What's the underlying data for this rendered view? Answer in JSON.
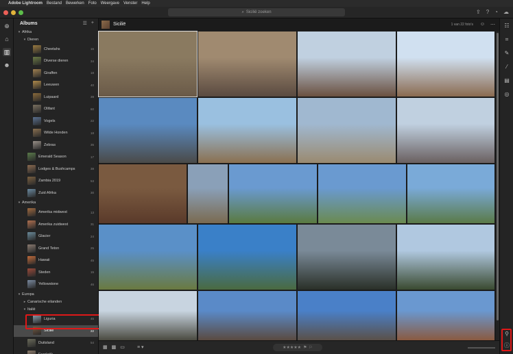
{
  "menubar": {
    "items": [
      "Adobe Lightroom",
      "Bestand",
      "Bewerken",
      "Foto",
      "Weergave",
      "Venster",
      "Help"
    ]
  },
  "search": {
    "placeholder": "Sicilië zoeken"
  },
  "panel": {
    "title": "Albums",
    "tree": [
      {
        "type": "group",
        "indent": 0,
        "label": "Afrika"
      },
      {
        "type": "group",
        "indent": 1,
        "label": "Dieren"
      },
      {
        "type": "album",
        "indent": 2,
        "label": "Cheetahs",
        "count": "16",
        "color": "#9a7a40"
      },
      {
        "type": "album",
        "indent": 2,
        "label": "Diverse dieren",
        "count": "34",
        "color": "#6b7a45"
      },
      {
        "type": "album",
        "indent": 2,
        "label": "Giraffen",
        "count": "18",
        "color": "#a08050"
      },
      {
        "type": "album",
        "indent": 2,
        "label": "Leeuwen",
        "count": "40",
        "color": "#b08a4a"
      },
      {
        "type": "album",
        "indent": 2,
        "label": "Luipaard",
        "count": "39",
        "color": "#8a6a3a"
      },
      {
        "type": "album",
        "indent": 2,
        "label": "Olifant",
        "count": "60",
        "color": "#7a7060"
      },
      {
        "type": "album",
        "indent": 2,
        "label": "Vogels",
        "count": "22",
        "color": "#5a7090"
      },
      {
        "type": "album",
        "indent": 2,
        "label": "Wilde Honden",
        "count": "18",
        "color": "#8a7050"
      },
      {
        "type": "album",
        "indent": 2,
        "label": "Zebras",
        "count": "35",
        "color": "#999088"
      },
      {
        "type": "album",
        "indent": 1,
        "label": "Emerald Season",
        "count": "17",
        "color": "#5a7a4a"
      },
      {
        "type": "album",
        "indent": 1,
        "label": "Lodges & Bushcamps",
        "count": "38",
        "color": "#8a6a50"
      },
      {
        "type": "album",
        "indent": 1,
        "label": "Zambia 2019",
        "count": "53",
        "color": "#7a6040"
      },
      {
        "type": "album",
        "indent": 1,
        "label": "Zuid Afrika",
        "count": "30",
        "color": "#6a8aa0"
      },
      {
        "type": "group",
        "indent": 0,
        "label": "Amerika"
      },
      {
        "type": "album",
        "indent": 1,
        "label": "Amerika midwest",
        "count": "13",
        "color": "#a06a40"
      },
      {
        "type": "album",
        "indent": 1,
        "label": "Amerika zuidwest",
        "count": "31",
        "color": "#b07050"
      },
      {
        "type": "album",
        "indent": 1,
        "label": "Glacier",
        "count": "24",
        "color": "#6a8a9a"
      },
      {
        "type": "album",
        "indent": 1,
        "label": "Grand Teton",
        "count": "25",
        "color": "#8a7a70"
      },
      {
        "type": "album",
        "indent": 1,
        "label": "Hawaii",
        "count": "45",
        "color": "#c06a3a"
      },
      {
        "type": "album",
        "indent": 1,
        "label": "Steden",
        "count": "15",
        "color": "#9a4a3a"
      },
      {
        "type": "album",
        "indent": 1,
        "label": "Yellowstone",
        "count": "46",
        "color": "#7a8aa0"
      },
      {
        "type": "group",
        "indent": 0,
        "label": "Europa"
      },
      {
        "type": "group",
        "indent": 1,
        "label": "Canarische eilanden",
        "collapsed": true
      },
      {
        "type": "group",
        "indent": 1,
        "label": "Italië"
      },
      {
        "type": "album",
        "indent": 2,
        "label": "Liguria",
        "count": "45",
        "color": "#8aa0b0"
      },
      {
        "type": "album",
        "indent": 2,
        "label": "Sicilië",
        "count": "22",
        "color": "#7a5a40",
        "selected": true
      },
      {
        "type": "album",
        "indent": 1,
        "label": "Duitsland",
        "count": "54",
        "color": "#6a6a5a"
      },
      {
        "type": "album",
        "indent": 1,
        "label": "Frankrijk",
        "count": "43",
        "color": "#8a7a6a"
      }
    ]
  },
  "main": {
    "album_title": "Sicilië",
    "status": "1 van 22 foto's"
  },
  "photos": [
    {
      "row": 0,
      "w": 0.25,
      "sky": "#8a7a60",
      "ground": "#6a5a48",
      "sel": true
    },
    {
      "row": 0,
      "w": 0.25,
      "sky": "#a08a70",
      "ground": "#5a4a40"
    },
    {
      "row": 0,
      "w": 0.25,
      "sky": "#c0d0e0",
      "ground": "#6a5040"
    },
    {
      "row": 0,
      "w": 0.25,
      "sky": "#d0e0f0",
      "ground": "#8a6a50"
    },
    {
      "row": 1,
      "w": 0.25,
      "sky": "#5a8ac0",
      "ground": "#4a4a48"
    },
    {
      "row": 1,
      "w": 0.25,
      "sky": "#9ac0e0",
      "ground": "#8a7050"
    },
    {
      "row": 1,
      "w": 0.25,
      "sky": "#a0b8d0",
      "ground": "#9a8a70"
    },
    {
      "row": 1,
      "w": 0.25,
      "sky": "#c0d0e0",
      "ground": "#6a6060"
    },
    {
      "row": 2,
      "w": 0.22,
      "sky": "#7a5a40",
      "ground": "#5a3a2a"
    },
    {
      "row": 2,
      "w": 0.1,
      "sky": "#8aa0b8",
      "ground": "#7a6a50"
    },
    {
      "row": 2,
      "w": 0.22,
      "sky": "#6a9ad0",
      "ground": "#5a7a40"
    },
    {
      "row": 2,
      "w": 0.22,
      "sky": "#6a9ad0",
      "ground": "#6a8a50"
    },
    {
      "row": 2,
      "w": 0.22,
      "sky": "#7aaad8",
      "ground": "#5a7a48"
    },
    {
      "row": 3,
      "w": 0.25,
      "sky": "#5a90c8",
      "ground": "#6a7a40"
    },
    {
      "row": 3,
      "w": 0.25,
      "sky": "#3a80c8",
      "ground": "#4a6a40"
    },
    {
      "row": 3,
      "w": 0.25,
      "sky": "#7a8a98",
      "ground": "#2a3028"
    },
    {
      "row": 3,
      "w": 0.25,
      "sky": "#b0c8e0",
      "ground": "#3a4a30"
    },
    {
      "row": 4,
      "w": 0.25,
      "sky": "#c8d4e0",
      "ground": "#4a4a40"
    },
    {
      "row": 4,
      "w": 0.25,
      "sky": "#5a8ac8",
      "ground": "#5a4a40"
    },
    {
      "row": 4,
      "w": 0.25,
      "sky": "#4a80c8",
      "ground": "#5a5048"
    },
    {
      "row": 4,
      "w": 0.25,
      "sky": "#6a98d0",
      "ground": "#8a5a40"
    }
  ],
  "bottombar": {
    "stars": "★★★★★"
  },
  "accent": "#e01818"
}
